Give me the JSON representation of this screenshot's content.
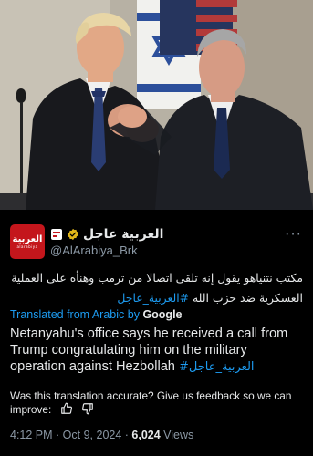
{
  "tweet": {
    "author": {
      "logo_main": "العربية",
      "logo_sub": "alarabiya",
      "display_name": "العربية عاجل",
      "handle": "@AlArabiya_Brk",
      "verified_icon": "verified-badge-icon",
      "secondary_icon": "affiliate-badge-icon"
    },
    "more_label": "···",
    "original_text": "مكتب نتنياهو يقول إنه تلقى اتصالا من ترمب وهنأه على العملية العسكرية ضد حزب الله ",
    "original_hashtag": "#العربية_عاجل",
    "translated_prefix": "Translated from Arabic by ",
    "translated_provider": "Google",
    "translated_text": "Netanyahu's office says he received a call from Trump congratulating him on the military operation against Hezbollah ",
    "translated_hashtag": "#العربية_عاجل",
    "feedback_text": "Was this translation accurate? Give us feedback so we can improve:",
    "feedback_icons": [
      "thumbs-up-icon",
      "thumbs-down-icon"
    ],
    "time": "4:12 PM",
    "separator": " · ",
    "date": "Oct 9, 2024",
    "views_count": "6,024",
    "views_label": " Views"
  },
  "colors": {
    "background": "#000000",
    "text": "#e7e9ea",
    "secondary_text": "#8b98a5",
    "link": "#1d9bf0",
    "brand_red": "#c4161c",
    "verified_gold": "#e2b719"
  }
}
